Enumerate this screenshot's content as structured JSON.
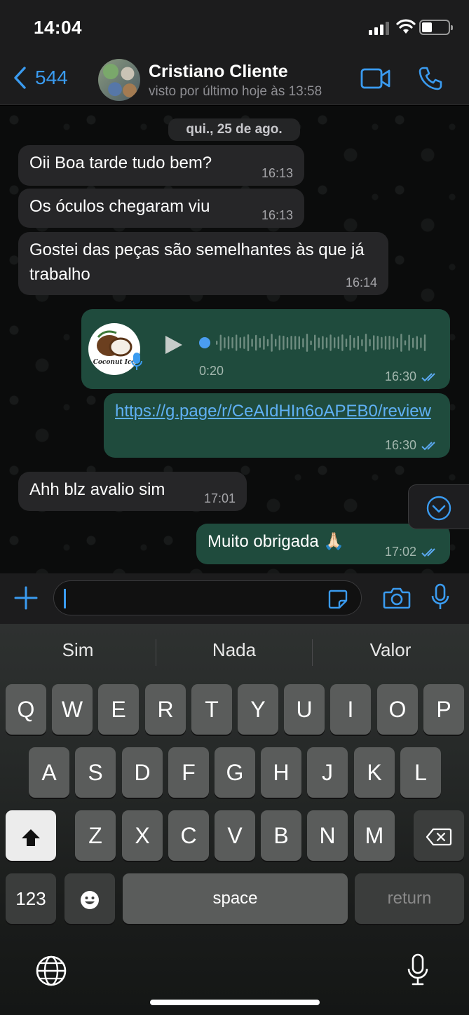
{
  "status_bar": {
    "time": "14:04"
  },
  "header": {
    "back_count": "544",
    "contact_name": "Cristiano Cliente",
    "contact_status": "visto por último hoje às 13:58"
  },
  "chat": {
    "date_label": "qui., 25 de ago.",
    "messages": [
      {
        "text": "Oii Boa tarde tudo bem?",
        "time": "16:13"
      },
      {
        "text": "Os óculos chegaram viu",
        "time": "16:13"
      },
      {
        "text": "Gostei das peças são semelhantes às que já trabalho",
        "time": "16:14"
      },
      {
        "duration": "0:20",
        "time": "16:30",
        "avatar_text": "Coconut Ice"
      },
      {
        "text": "https://g.page/r/CeAIdHIn6oAPEB0/review",
        "time": "16:30"
      },
      {
        "text": "Ahh blz avalio sim",
        "time": "17:01"
      },
      {
        "text": "Muito obrigada 🙏🏻",
        "time": "17:02"
      }
    ]
  },
  "input": {
    "placeholder": ""
  },
  "keyboard": {
    "suggestions": [
      "Sim",
      "Nada",
      "Valor"
    ],
    "row1": [
      "Q",
      "W",
      "E",
      "R",
      "T",
      "Y",
      "U",
      "I",
      "O",
      "P"
    ],
    "row2": [
      "A",
      "S",
      "D",
      "F",
      "G",
      "H",
      "J",
      "K",
      "L"
    ],
    "row3": [
      "Z",
      "X",
      "C",
      "V",
      "B",
      "N",
      "M"
    ],
    "numbers_label": "123",
    "space_label": "space",
    "return_label": "return"
  },
  "colors": {
    "accent": "#3a9bf0",
    "outgoing_bubble": "#1f4b3d",
    "incoming_bubble": "#262628"
  }
}
